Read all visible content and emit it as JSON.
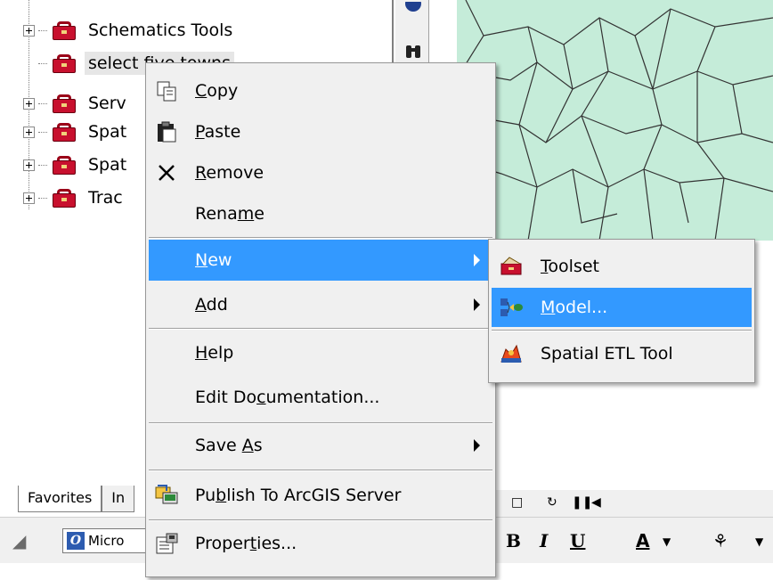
{
  "tree": {
    "items": [
      {
        "label": "Schematics Tools",
        "expandable": true
      },
      {
        "label": "select five towns",
        "expandable": false,
        "selected": true
      },
      {
        "label": "Serv",
        "expandable": true
      },
      {
        "label": "Spat",
        "expandable": true
      },
      {
        "label": "Spat",
        "expandable": true
      },
      {
        "label": "Trac",
        "expandable": true
      }
    ]
  },
  "tabs": [
    {
      "label": "Favorites"
    },
    {
      "label": "In"
    }
  ],
  "bottom": {
    "font_value": "Micro",
    "bold_label": "B",
    "italic_label": "I",
    "underline_label": "U",
    "font_color_label": "A",
    "fill_label": "⚘"
  },
  "context_menu": {
    "items": [
      {
        "pre": "",
        "mn": "C",
        "post": "opy",
        "icon": "copy-icon"
      },
      {
        "pre": "",
        "mn": "P",
        "post": "aste",
        "icon": "paste-icon"
      },
      {
        "pre": "",
        "mn": "R",
        "post": "emove",
        "icon": "remove-icon"
      },
      {
        "pre": "Rena",
        "mn": "m",
        "post": "e",
        "icon": ""
      },
      {
        "pre": "",
        "mn": "N",
        "post": "ew",
        "icon": "",
        "submenu": true,
        "highlighted": true
      },
      {
        "pre": "",
        "mn": "A",
        "post": "dd",
        "icon": "",
        "submenu": true
      },
      {
        "pre": "",
        "mn": "H",
        "post": "elp",
        "icon": ""
      },
      {
        "pre": "Edit Do",
        "mn": "c",
        "post": "umentation...",
        "icon": ""
      },
      {
        "pre": "Save ",
        "mn": "A",
        "post": "s",
        "icon": "",
        "submenu": true
      },
      {
        "pre": "Pu",
        "mn": "b",
        "post": "lish To ArcGIS Server",
        "icon": "publish-icon"
      },
      {
        "pre": "Proper",
        "mn": "t",
        "post": "ies...",
        "icon": "properties-icon"
      }
    ]
  },
  "submenu": {
    "items": [
      {
        "pre": "",
        "mn": "T",
        "post": "oolset",
        "icon": "toolset-icon"
      },
      {
        "pre": "",
        "mn": "M",
        "post": "odel...",
        "icon": "model-icon",
        "highlighted": true
      },
      {
        "pre": "Spatial ETL Tool",
        "mn": "",
        "post": "",
        "icon": "spatial-etl-icon"
      }
    ]
  },
  "colors": {
    "menu_highlight": "#3399ff",
    "map_fill": "#c5ecd9",
    "toolbox_red": "#c8102e"
  }
}
